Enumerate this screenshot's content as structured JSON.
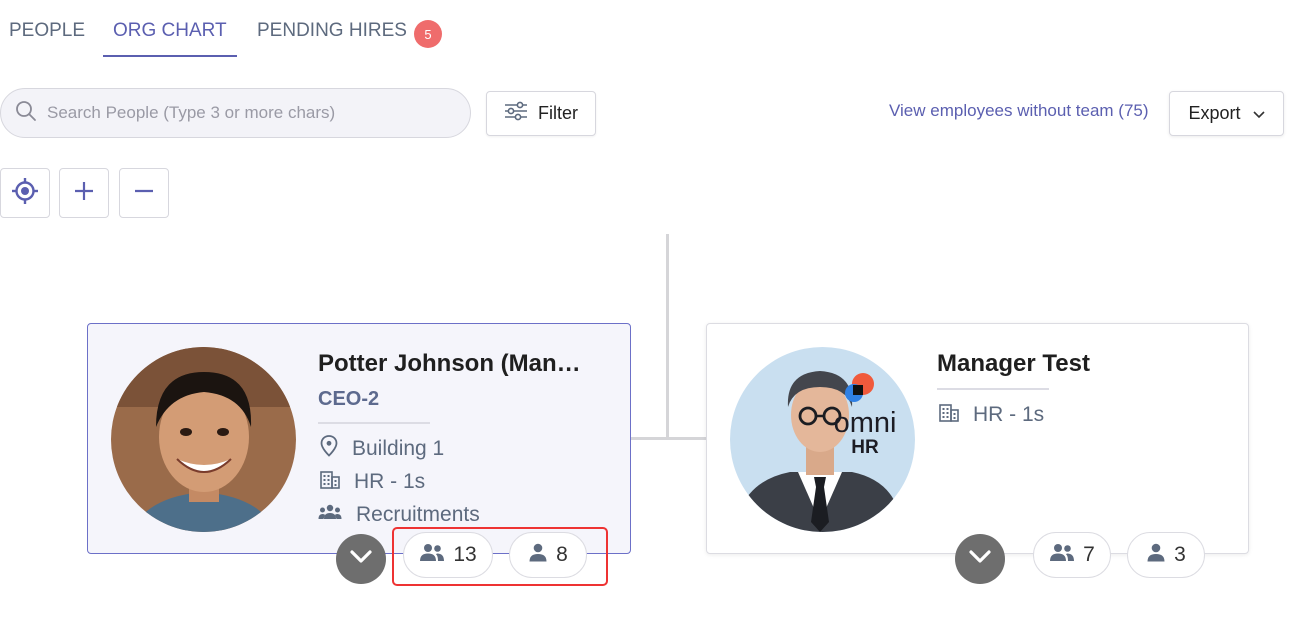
{
  "tabs": [
    {
      "label": "PEOPLE"
    },
    {
      "label": "ORG CHART"
    },
    {
      "label": "PENDING HIRES"
    }
  ],
  "pending_count": "5",
  "active_tab": "ORG CHART",
  "search": {
    "placeholder": "Search People (Type 3 or more chars)"
  },
  "toolbar": {
    "filter_label": "Filter",
    "no_team_link": "View employees without team (75)",
    "export_label": "Export"
  },
  "zoom_controls": {
    "icons": [
      "locate-icon",
      "plus-icon",
      "minus-icon"
    ]
  },
  "cards": [
    {
      "name": "Potter Johnson (Man…",
      "title": "CEO-2",
      "location": "Building 1",
      "department": "HR - 1s",
      "team": "Recruitments",
      "group_count": "13",
      "direct_count": "8",
      "selected": true
    },
    {
      "name": "Manager Test",
      "department": "HR - 1s",
      "avatar_text_1": "omni",
      "avatar_text_2": "HR",
      "group_count": "7",
      "direct_count": "3",
      "selected": false
    }
  ],
  "colors": {
    "accent": "#5b5fb0",
    "badge": "#ef6c6c",
    "highlight": "#ee3333",
    "selected_card_bg": "#f5f5fb"
  }
}
